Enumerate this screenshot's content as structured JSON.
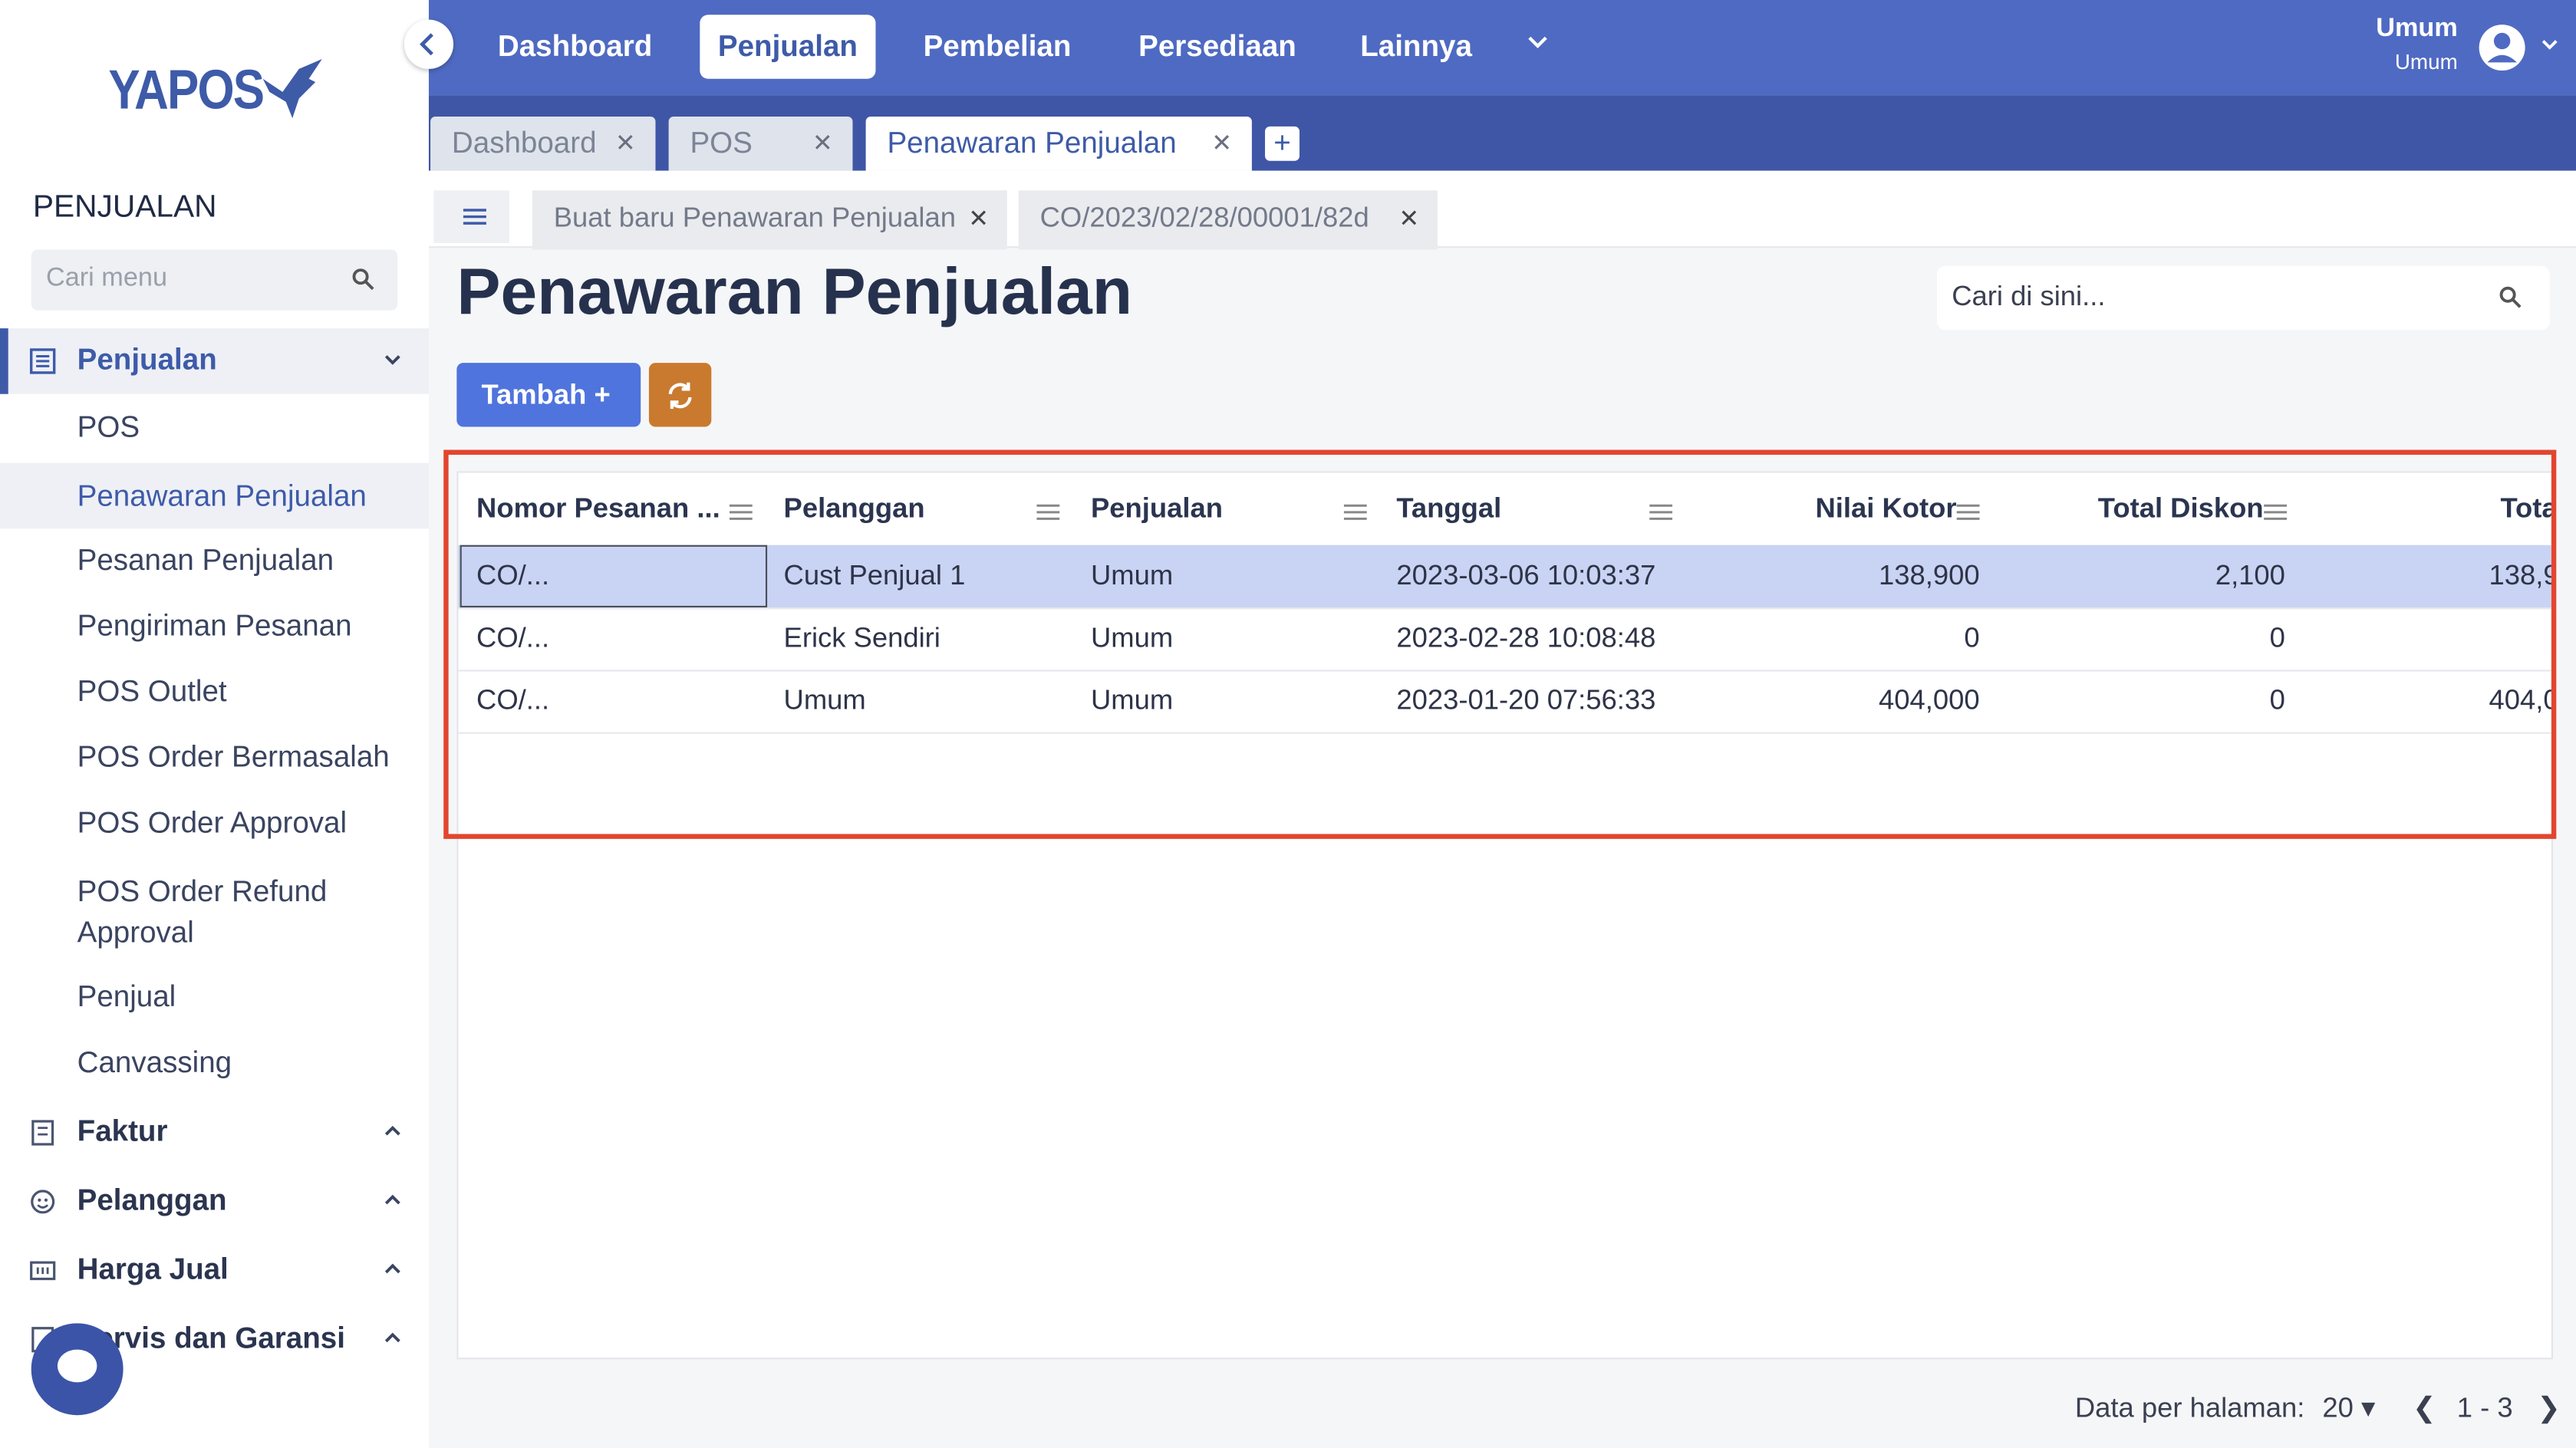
{
  "logo": {
    "text": "YAPOS"
  },
  "sidebar": {
    "heading": "PENJUALAN",
    "search_placeholder": "Cari menu",
    "groups": [
      {
        "label": "Penjualan",
        "icon": "receipt-icon"
      },
      {
        "label": "Faktur",
        "icon": "invoice-icon"
      },
      {
        "label": "Pelanggan",
        "icon": "customer-icon"
      },
      {
        "label": "Harga Jual",
        "icon": "price-icon"
      },
      {
        "label": "Servis dan Garansi",
        "icon": "service-icon"
      }
    ],
    "items": [
      "POS",
      "Penawaran Penjualan",
      "Pesanan Penjualan",
      "Pengiriman Pesanan",
      "POS Outlet",
      "POS Order Bermasalah",
      "POS Order Approval",
      "POS Order Refund Approval",
      "Penjual",
      "Canvassing"
    ]
  },
  "topnav": {
    "items": [
      "Dashboard",
      "Penjualan",
      "Pembelian",
      "Persediaan",
      "Lainnya"
    ],
    "active": "Penjualan",
    "user_name": "Umum",
    "user_role": "Umum"
  },
  "tabs": [
    "Dashboard",
    "POS",
    "Penawaran Penjualan"
  ],
  "active_tab": "Penawaran Penjualan",
  "subtabs": [
    "Buat baru Penawaran Penjualan",
    "CO/2023/02/28/00001/82d"
  ],
  "page": {
    "title": "Penawaran Penjualan",
    "search_placeholder": "Cari di sini...",
    "add_button": "Tambah +"
  },
  "table": {
    "columns": [
      "Nomor Pesanan ...",
      "Pelanggan",
      "Penjualan",
      "Tanggal",
      "Nilai Kotor",
      "Total Diskon",
      "Tota"
    ],
    "rows": [
      [
        "CO/...",
        "Cust Penjual 1",
        "Umum",
        "2023-03-06 10:03:37",
        "138,900",
        "2,100",
        "138,9"
      ],
      [
        "CO/...",
        "Erick Sendiri",
        "Umum",
        "2023-02-28 10:08:48",
        "0",
        "0",
        ""
      ],
      [
        "CO/...",
        "Umum",
        "Umum",
        "2023-01-20 07:56:33",
        "404,000",
        "0",
        "404,0"
      ]
    ]
  },
  "pagination": {
    "label": "Data per halaman:",
    "per_page": "20",
    "range": "1 - 3"
  },
  "colors": {
    "primary": "#4f6ac2",
    "tabbar": "#3f56a6",
    "accent": "#3e5ba8",
    "highlight": "#e2452f",
    "refresh": "#c97a2e"
  }
}
